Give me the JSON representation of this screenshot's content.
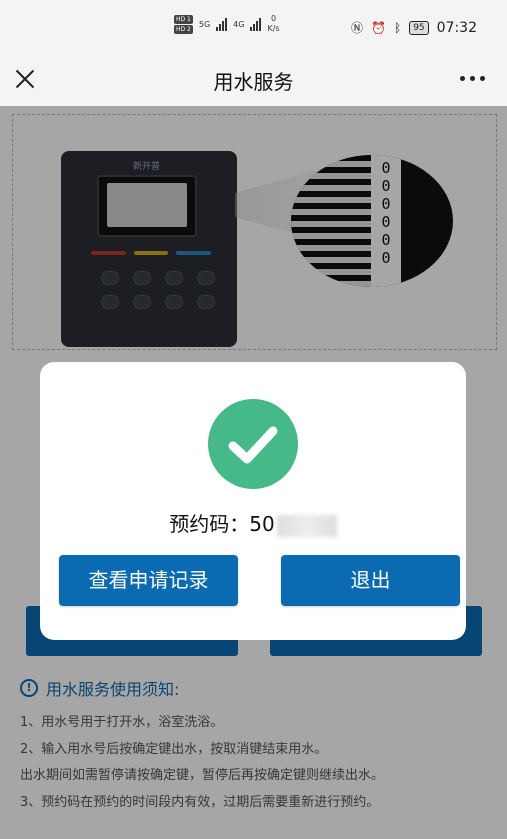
{
  "status_bar": {
    "hd1": "HD 1",
    "hd2": "HD 2",
    "net1": "5G",
    "net2": "4G",
    "speed_value": "0",
    "speed_unit": "K/s",
    "battery": "95",
    "time": "07:32"
  },
  "header": {
    "title": "用水服务"
  },
  "illustration": {
    "brand": "新开普",
    "code_digits": "0\n0\n0\n0\n0\n0"
  },
  "dialog": {
    "code_label": "预约码：",
    "code_visible": "50",
    "records_button": "查看申请记录",
    "exit_button": "退出"
  },
  "notice": {
    "title": "用水服务使用须知:",
    "lines": [
      "1、用水号用于打开水，浴室洗浴。",
      "2、输入用水号后按确定键出水，按取消键结束用水。",
      "出水期间如需暂停请按确定键，暂停后再按确定键则继续出水。",
      "3、预约码在预约的时间段内有效，过期后需要重新进行预约。"
    ]
  },
  "colors": {
    "primary": "#0a6bb3",
    "success": "#45b987"
  }
}
